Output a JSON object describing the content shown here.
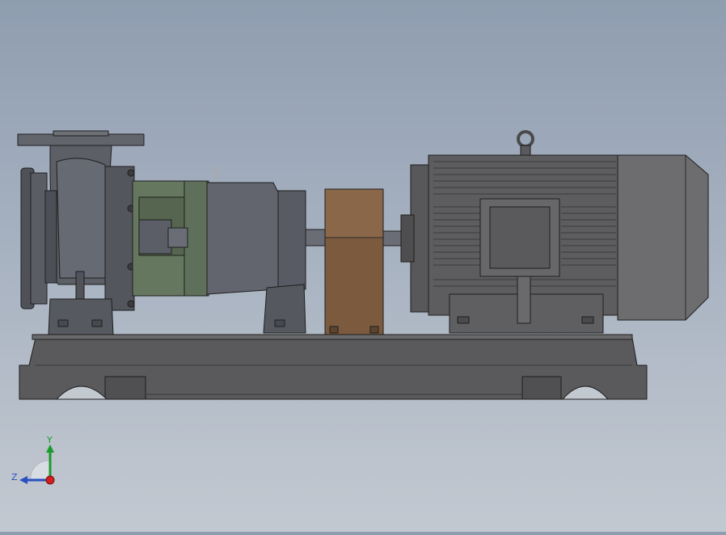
{
  "viewport": {
    "background_top": "#8f9db0",
    "background_bottom": "#c3c9d1"
  },
  "model": {
    "colors": {
      "base": "#5a5a5c",
      "pump_casing": "#5c5f66",
      "bracket_green": "#65775f",
      "bearing_housing": "#62656e",
      "coupling_guard": "#7b5a3e",
      "motor_body": "#5d5d5f",
      "motor_fan_cover": "#6d6d70",
      "edge_line": "#1e1e1e"
    }
  },
  "triad": {
    "y_label": "Y",
    "z_label": "Z",
    "y_color": "#1a9a2a",
    "z_color": "#2a4fbf",
    "x_color": "#d21e1e"
  }
}
